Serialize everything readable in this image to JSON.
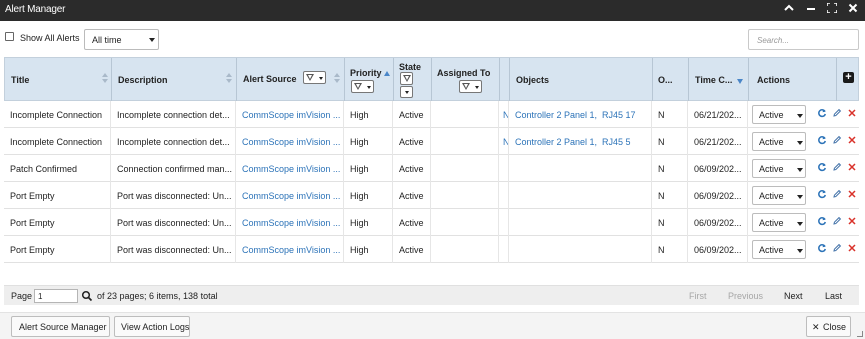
{
  "window": {
    "title": "Alert Manager",
    "controls": {
      "collapse": "⌃",
      "minimize": "‒",
      "maximize": "⛶",
      "close": "✕"
    }
  },
  "toolbar": {
    "show_all_label": "Show All Alerts",
    "show_all_checked": false,
    "time_filter": "All time",
    "search_placeholder": "Search..."
  },
  "grid": {
    "columns": {
      "title": "Title",
      "description": "Description",
      "alert_source": "Alert Source",
      "priority": "Priority",
      "state": "State",
      "assigned_to": "Assigned To",
      "objects": "Objects",
      "o": "O...",
      "time": "Time C...",
      "actions": "Actions"
    },
    "rows": [
      {
        "title": "Incomplete Connection",
        "description": "Incomplete connection det...",
        "source": "CommScope imVision ...",
        "priority": "High",
        "state": "Active",
        "assigned": "",
        "n": "N",
        "obj1": "Controller 2 Panel 1,",
        "obj2": "RJ45 17",
        "o": "N",
        "time": "06/21/202...",
        "action": "Active"
      },
      {
        "title": "Incomplete Connection",
        "description": "Incomplete connection det...",
        "source": "CommScope imVision ...",
        "priority": "High",
        "state": "Active",
        "assigned": "",
        "n": "N",
        "obj1": "Controller 2 Panel 1,",
        "obj2": "RJ45 5",
        "o": "N",
        "time": "06/21/202...",
        "action": "Active"
      },
      {
        "title": "Patch Confirmed",
        "description": "Connection confirmed man...",
        "source": "CommScope imVision ...",
        "priority": "High",
        "state": "Active",
        "assigned": "",
        "n": "",
        "obj1": "",
        "obj2": "",
        "o": "N",
        "time": "06/09/202...",
        "action": "Active"
      },
      {
        "title": "Port Empty",
        "description": "Port was disconnected: Un...",
        "source": "CommScope imVision ...",
        "priority": "High",
        "state": "Active",
        "assigned": "",
        "n": "",
        "obj1": "",
        "obj2": "",
        "o": "N",
        "time": "06/09/202...",
        "action": "Active"
      },
      {
        "title": "Port Empty",
        "description": "Port was disconnected: Un...",
        "source": "CommScope imVision ...",
        "priority": "High",
        "state": "Active",
        "assigned": "",
        "n": "",
        "obj1": "",
        "obj2": "",
        "o": "N",
        "time": "06/09/202...",
        "action": "Active"
      },
      {
        "title": "Port Empty",
        "description": "Port was disconnected: Un...",
        "source": "CommScope imVision ...",
        "priority": "High",
        "state": "Active",
        "assigned": "",
        "n": "",
        "obj1": "",
        "obj2": "",
        "o": "N",
        "time": "06/09/202...",
        "action": "Active"
      }
    ]
  },
  "pager": {
    "page_label": "Page",
    "page_value": "1",
    "info": "of 23 pages; 6 items, 138 total",
    "first": "First",
    "previous": "Previous",
    "next": "Next",
    "last": "Last"
  },
  "footer": {
    "alert_source_manager": "Alert Source Manager",
    "view_action_logs": "View Action Logs",
    "close": "Close"
  },
  "colors": {
    "titlebar": "#2b2b2b",
    "header_bg": "#d7e4f0",
    "link": "#2c73b8",
    "refresh_icon": "#2c73b8",
    "delete_icon": "#d9322a",
    "sort_active": "#4a86c8"
  },
  "icons": {
    "refresh": "refresh-icon",
    "edit": "pencil-icon",
    "delete": "close-icon",
    "add_column": "plus-icon",
    "search_go": "search-icon"
  }
}
